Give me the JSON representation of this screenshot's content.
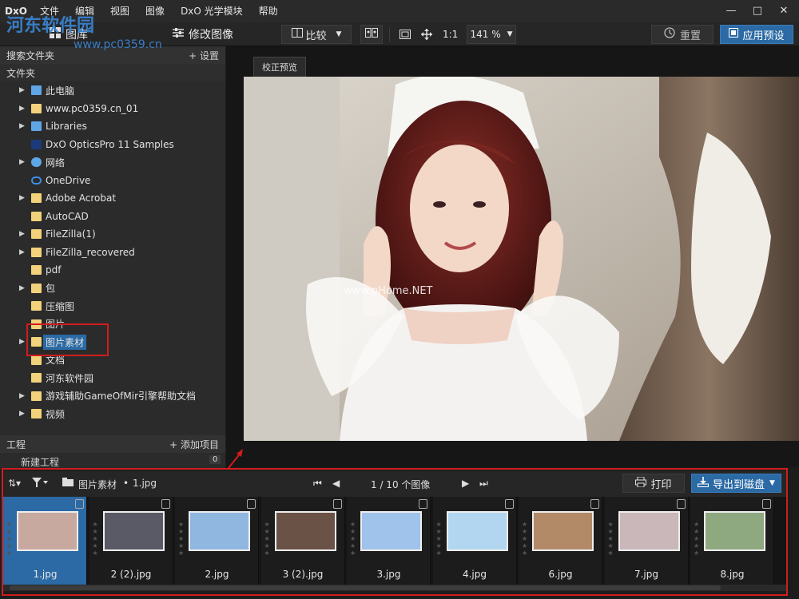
{
  "menubar": {
    "logo": "DxO",
    "items": [
      "文件",
      "编辑",
      "视图",
      "图像",
      "DxO 光学模块",
      "帮助"
    ],
    "minimize": "—",
    "maximize": "□",
    "close": "✕"
  },
  "toolbar": {
    "library_label": "图库",
    "customize_label": "修改图像",
    "compare_label": "比较",
    "one_to_one": "1:1",
    "zoom_value": "141 %",
    "reset_label": "重置",
    "apply_preset_label": "应用预设"
  },
  "leftpanel": {
    "search_label": "搜索文件夹",
    "settings_label": "+ 设置",
    "folders_label": "文件夹",
    "tree": [
      {
        "label": "此电脑",
        "icon": "computer-icon",
        "arrow": true
      },
      {
        "label": "www.pc0359.cn_01",
        "icon": "folder-icon",
        "arrow": true
      },
      {
        "label": "Libraries",
        "icon": "library-icon",
        "arrow": true
      },
      {
        "label": "DxO OpticsPro 11 Samples",
        "icon": "dxo-icon",
        "arrow": false
      },
      {
        "label": "网络",
        "icon": "network-icon",
        "arrow": true
      },
      {
        "label": "OneDrive",
        "icon": "cloud-icon",
        "arrow": false
      },
      {
        "label": "Adobe Acrobat",
        "icon": "folder-icon",
        "arrow": true
      },
      {
        "label": "AutoCAD",
        "icon": "folder-icon",
        "arrow": false
      },
      {
        "label": "FileZilla(1)",
        "icon": "folder-icon",
        "arrow": true
      },
      {
        "label": "FileZilla_recovered",
        "icon": "folder-icon",
        "arrow": true
      },
      {
        "label": "pdf",
        "icon": "folder-icon",
        "arrow": false
      },
      {
        "label": "包",
        "icon": "folder-icon",
        "arrow": true
      },
      {
        "label": "压缩图",
        "icon": "folder-icon",
        "arrow": false
      },
      {
        "label": "图片",
        "icon": "folder-icon",
        "arrow": false
      },
      {
        "label": "图片素材",
        "icon": "folder-icon",
        "arrow": true,
        "selected": true
      },
      {
        "label": "文档",
        "icon": "folder-icon",
        "arrow": false
      },
      {
        "label": "河东软件园",
        "icon": "folder-icon",
        "arrow": false
      },
      {
        "label": "游戏辅助GameOfMir引擎帮助文档",
        "icon": "folder-icon",
        "arrow": true
      },
      {
        "label": "视频",
        "icon": "folder-icon",
        "arrow": true
      }
    ],
    "project_label": "工程",
    "add_item_label": "+ 添加项目",
    "new_project_label": "新建工程",
    "new_project_count": "0"
  },
  "viewer": {
    "tab_label": "校正预览",
    "watermark_center": "www.pHome.NET",
    "watermark_logo": "河东软件园",
    "watermark_url": "www.pc0359.cn"
  },
  "filmstrip": {
    "folder_name": "图片素材",
    "dot": "•",
    "file_name": "1.jpg",
    "page_info": "1 / 10  个图像",
    "print_label": "打印",
    "export_label": "导出到磁盘",
    "thumbs": [
      {
        "caption": "1.jpg",
        "selected": true,
        "color": "#c8a9a0"
      },
      {
        "caption": "2 (2).jpg",
        "selected": false,
        "color": "#5a5a66"
      },
      {
        "caption": "2.jpg",
        "selected": false,
        "color": "#8fb7e0"
      },
      {
        "caption": "3 (2).jpg",
        "selected": false,
        "color": "#6a5346"
      },
      {
        "caption": "3.jpg",
        "selected": false,
        "color": "#9fc3ea"
      },
      {
        "caption": "4.jpg",
        "selected": false,
        "color": "#b2d6ef"
      },
      {
        "caption": "6.jpg",
        "selected": false,
        "color": "#b38a68"
      },
      {
        "caption": "7.jpg",
        "selected": false,
        "color": "#c9b7b9"
      },
      {
        "caption": "8.jpg",
        "selected": false,
        "color": "#8ea87f"
      }
    ]
  },
  "colors": {
    "accent": "#2b6aa4",
    "annotation_red": "#d21c1c",
    "folder": "#f2d37b"
  }
}
